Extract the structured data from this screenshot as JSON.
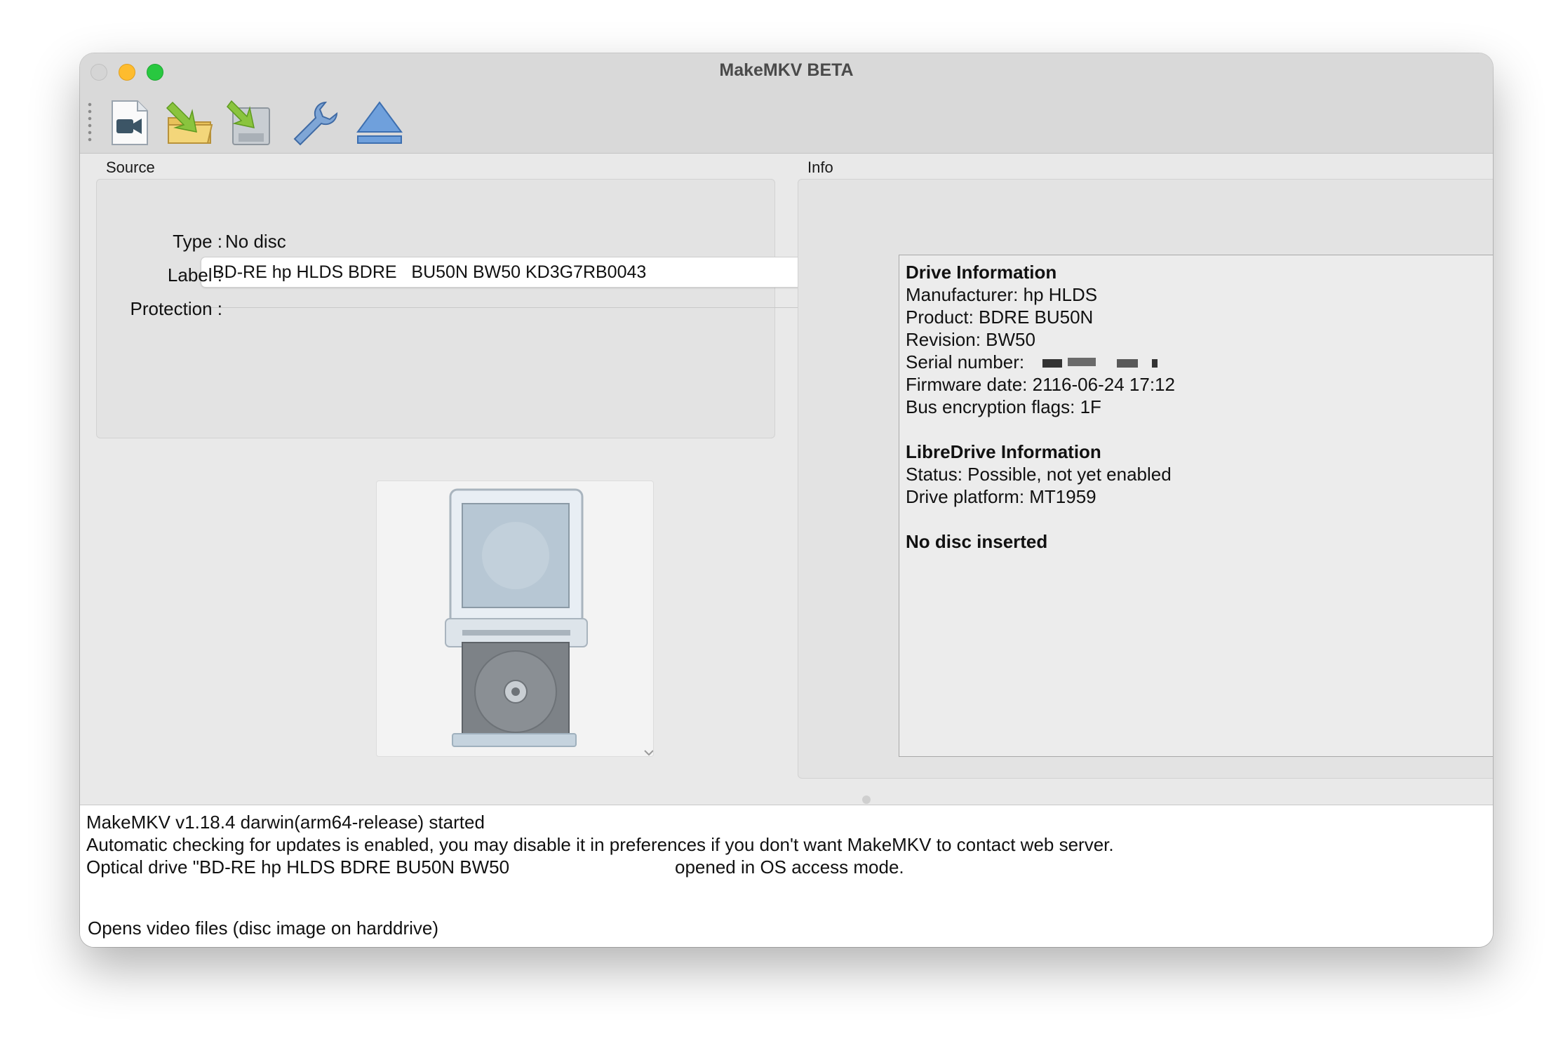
{
  "window": {
    "title": "MakeMKV BETA"
  },
  "toolbar": {
    "buttons": [
      {
        "name": "open-files",
        "icon": "video-file-icon"
      },
      {
        "name": "open-disc",
        "icon": "folder-arrow-icon"
      },
      {
        "name": "backup",
        "icon": "disk-arrow-icon"
      },
      {
        "name": "preferences",
        "icon": "wrench-icon"
      },
      {
        "name": "eject",
        "icon": "eject-icon"
      }
    ]
  },
  "source": {
    "label": "Source",
    "drive_select": "BD-RE hp HLDS BDRE   BU50N BW50 KD3G7RB0043",
    "type_label": "Type :",
    "type_value": "No disc",
    "label_label": "Label :",
    "label_value": "",
    "protection_label": "Protection :",
    "protection_value": ""
  },
  "info": {
    "label": "Info",
    "drive_heading": "Drive Information",
    "manufacturer": "Manufacturer: hp HLDS",
    "product": "Product: BDRE BU50N",
    "revision": "Revision: BW50",
    "serial": "Serial number:",
    "firmware": "Firmware date: 2116-06-24 17:12",
    "bus": "Bus encryption flags: 1F",
    "libredrive_heading": "LibreDrive Information",
    "libredrive_status": "Status: Possible, not yet enabled",
    "libredrive_platform": "Drive platform: MT1959",
    "no_disc": "No disc inserted"
  },
  "log": {
    "lines": [
      "MakeMKV v1.18.4 darwin(arm64-release) started",
      "Automatic checking for updates is enabled, you may disable it in preferences if you don't want MakeMKV to contact web server.",
      "Optical drive \"BD-RE hp HLDS BDRE BU50N BW50",
      "opened in OS access mode."
    ]
  },
  "status": {
    "text": "Opens video files (disc image on harddrive)"
  },
  "colors": {
    "accent": "#1f7cf2",
    "min": "#febc2e",
    "max": "#28c840"
  }
}
